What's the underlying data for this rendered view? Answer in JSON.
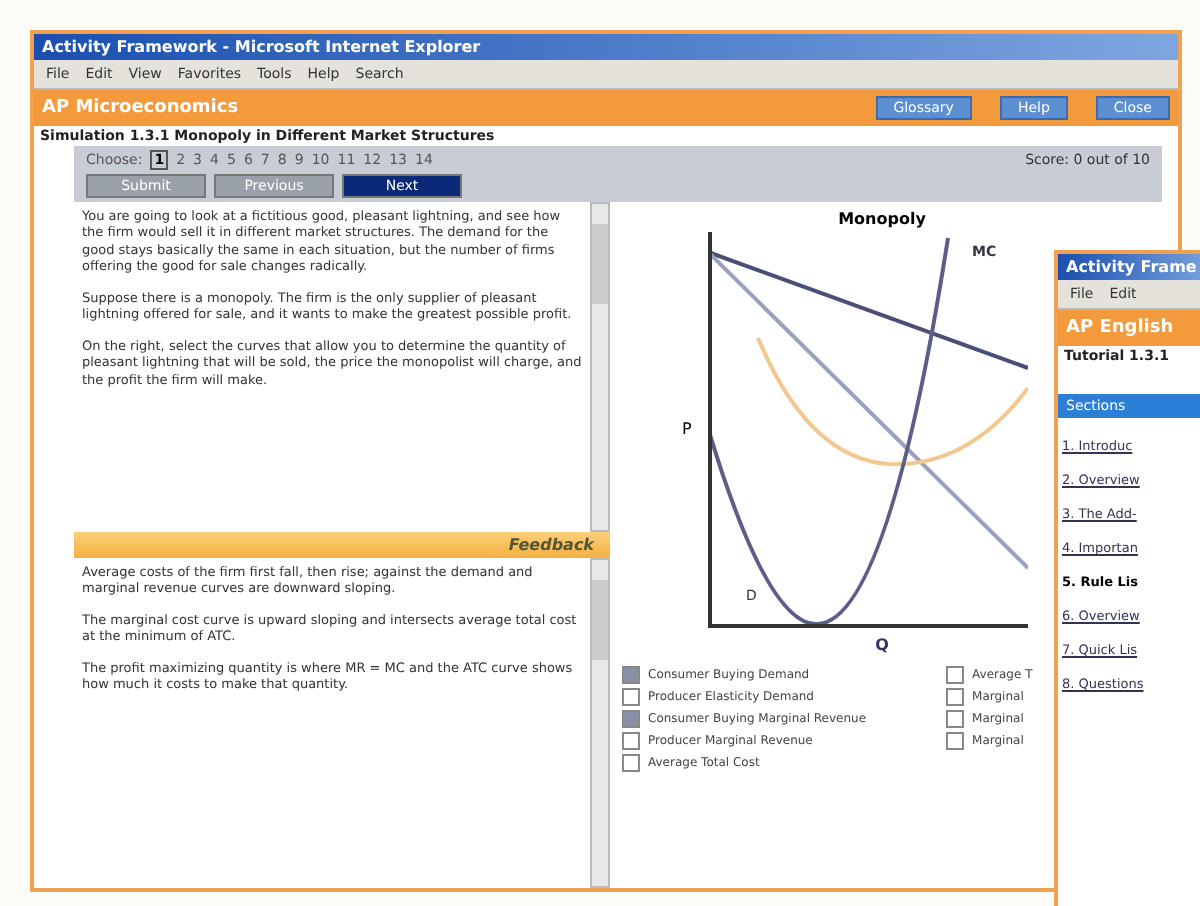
{
  "window": {
    "title": "Activity Framework - Microsoft Internet Explorer",
    "menu": [
      "File",
      "Edit",
      "View",
      "Favorites",
      "Tools",
      "Help"
    ],
    "toolbar_label": "Search"
  },
  "app_header": {
    "title": "AP Microeconomics",
    "buttons": [
      "Glossary",
      "Help",
      "Close"
    ]
  },
  "breadcrumb": "Simulation 1.3.1 Monopoly in Different Market Structures",
  "question_nav": {
    "label": "Choose:",
    "numbers": [
      {
        "label": "1",
        "selected": true
      },
      {
        "label": "2",
        "selected": false
      },
      {
        "label": "3",
        "selected": false
      },
      {
        "label": "4",
        "selected": false
      },
      {
        "label": "5",
        "selected": false
      },
      {
        "label": "6",
        "selected": false
      },
      {
        "label": "7",
        "selected": false
      },
      {
        "label": "8",
        "selected": false
      },
      {
        "label": "9",
        "selected": false
      },
      {
        "label": "10",
        "selected": false
      },
      {
        "label": "11",
        "selected": false
      },
      {
        "label": "12",
        "selected": false
      },
      {
        "label": "13",
        "selected": false
      },
      {
        "label": "14",
        "selected": false
      }
    ],
    "score": "Score: 0 out of 10",
    "buttons": [
      {
        "label": "Submit",
        "selected": false
      },
      {
        "label": "Previous",
        "selected": false
      },
      {
        "label": "Next",
        "selected": true
      }
    ]
  },
  "question_text": [
    "You are going to look at a fictitious good, pleasant lightning, and see how the firm would sell it in different market structures. The demand for the good stays basically the same in each situation, but the number of firms offering the good for sale changes radically.",
    "Suppose there is a monopoly. The firm is the only supplier of pleasant lightning offered for sale, and it wants to make the greatest possible profit.",
    "On the right, select the curves that allow you to determine the quantity of pleasant lightning that will be sold, the price the monopolist will charge, and the profit the firm will make."
  ],
  "feedback": {
    "heading": "Feedback",
    "paragraphs": [
      "Average costs of the firm first fall, then rise; against the demand and marginal revenue curves are downward sloping.",
      "The marginal cost curve is upward sloping and intersects average total cost at the minimum of ATC.",
      "The profit maximizing quantity is where MR = MC and the ATC curve shows how much it costs to make that quantity."
    ]
  },
  "chart": {
    "title": "Monopoly",
    "mc_label": "MC",
    "y_label": "P",
    "x_label": "Q",
    "d_label": "D"
  },
  "legend": {
    "left": [
      {
        "label": "Consumer Buying Demand",
        "checked": true
      },
      {
        "label": "Producer Elasticity Demand",
        "checked": false
      },
      {
        "label": "Consumer Buying Marginal Revenue",
        "checked": true
      },
      {
        "label": "Producer Marginal Revenue",
        "checked": false
      },
      {
        "label": "Average Total Cost",
        "checked": false
      }
    ],
    "right": [
      {
        "label": "Average T",
        "checked": false
      },
      {
        "label": "Marginal",
        "checked": false
      },
      {
        "label": "Marginal",
        "checked": false
      },
      {
        "label": "Marginal",
        "checked": false
      }
    ]
  },
  "second_window": {
    "title": "Activity Frame",
    "menu": [
      "File",
      "Edit"
    ],
    "header": "AP English",
    "breadcrumb": "Tutorial 1.3.1",
    "section": "Sections",
    "links": [
      {
        "label": "1. Introduc",
        "selected": false
      },
      {
        "label": "2. Overview",
        "selected": false
      },
      {
        "label": "3. The Add-",
        "selected": false
      },
      {
        "label": "4. Importan",
        "selected": false
      },
      {
        "label": "5. Rule Lis",
        "selected": true
      },
      {
        "label": "6. Overview",
        "selected": false
      },
      {
        "label": "7. Quick Lis",
        "selected": false
      },
      {
        "label": "8. Questions",
        "selected": false
      }
    ]
  }
}
